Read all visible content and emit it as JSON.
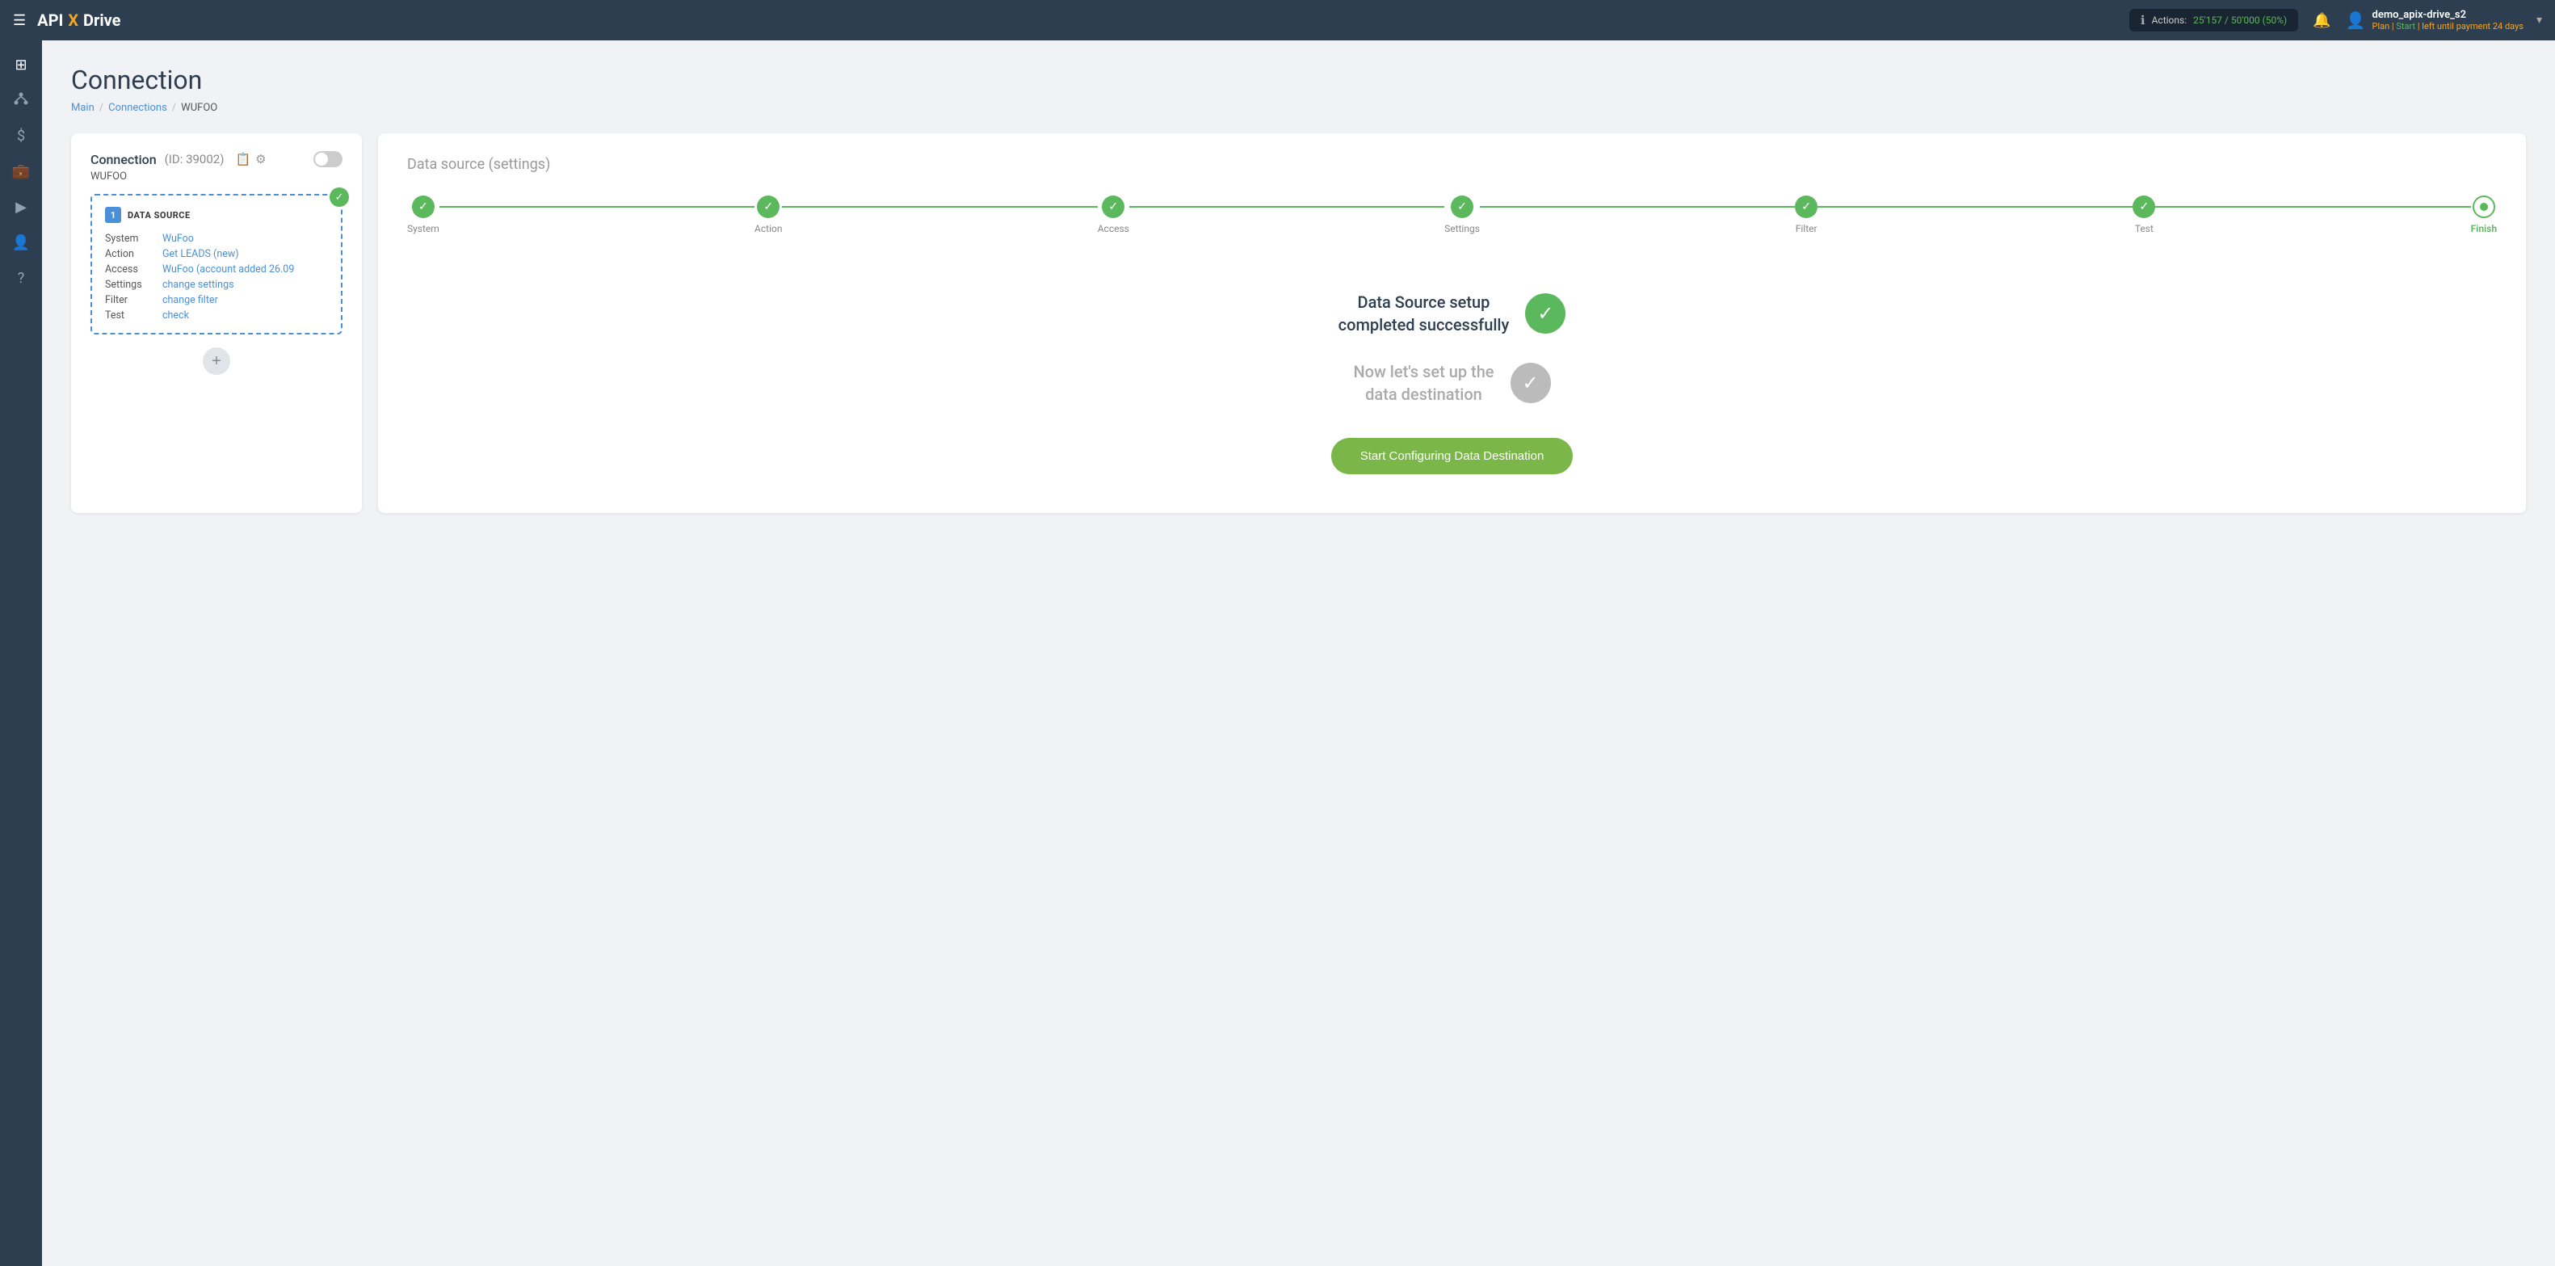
{
  "navbar": {
    "hamburger": "☰",
    "logo": {
      "api": "API",
      "x": "X",
      "drive": "Drive"
    },
    "actions": {
      "label": "Actions:",
      "progress": "25'157 / 50'000 (50%)"
    },
    "bell_icon": "🔔",
    "user": {
      "name": "demo_apix-drive_s2",
      "plan_label": "Plan |",
      "plan_value": "Start",
      "payment_text": "| left until payment",
      "days": "24 days"
    }
  },
  "page": {
    "title": "Connection",
    "breadcrumb": {
      "main": "Main",
      "connections": "Connections",
      "current": "WUFOO"
    }
  },
  "left_panel": {
    "title": "Connection",
    "id": "(ID: 39002)",
    "connection_name": "WUFOO",
    "datasource": {
      "number": "1",
      "label": "DATA SOURCE",
      "rows": [
        {
          "label": "System",
          "value": "WuFoo"
        },
        {
          "label": "Action",
          "value": "Get LEADS (new)"
        },
        {
          "label": "Access",
          "value": "WuFoo (account added 26.09"
        },
        {
          "label": "Settings",
          "value": "change settings"
        },
        {
          "label": "Filter",
          "value": "change filter"
        },
        {
          "label": "Test",
          "value": "check"
        }
      ]
    },
    "add_btn": "+"
  },
  "right_panel": {
    "title": "Data source",
    "title_suffix": "(settings)",
    "steps": [
      {
        "label": "System",
        "state": "done"
      },
      {
        "label": "Action",
        "state": "done"
      },
      {
        "label": "Access",
        "state": "done"
      },
      {
        "label": "Settings",
        "state": "done"
      },
      {
        "label": "Filter",
        "state": "done"
      },
      {
        "label": "Test",
        "state": "done"
      },
      {
        "label": "Finish",
        "state": "current"
      }
    ],
    "success": {
      "completed_text": "Data Source setup\ncompleted successfully",
      "next_text": "Now let's set up the\ndata destination",
      "button_label": "Start Configuring Data Destination"
    }
  },
  "sidebar": {
    "items": [
      {
        "icon": "⊞",
        "name": "dashboard"
      },
      {
        "icon": "⚡",
        "name": "connections"
      },
      {
        "icon": "$",
        "name": "billing"
      },
      {
        "icon": "💼",
        "name": "projects"
      },
      {
        "icon": "▶",
        "name": "media"
      },
      {
        "icon": "👤",
        "name": "profile"
      },
      {
        "icon": "?",
        "name": "help"
      }
    ]
  }
}
